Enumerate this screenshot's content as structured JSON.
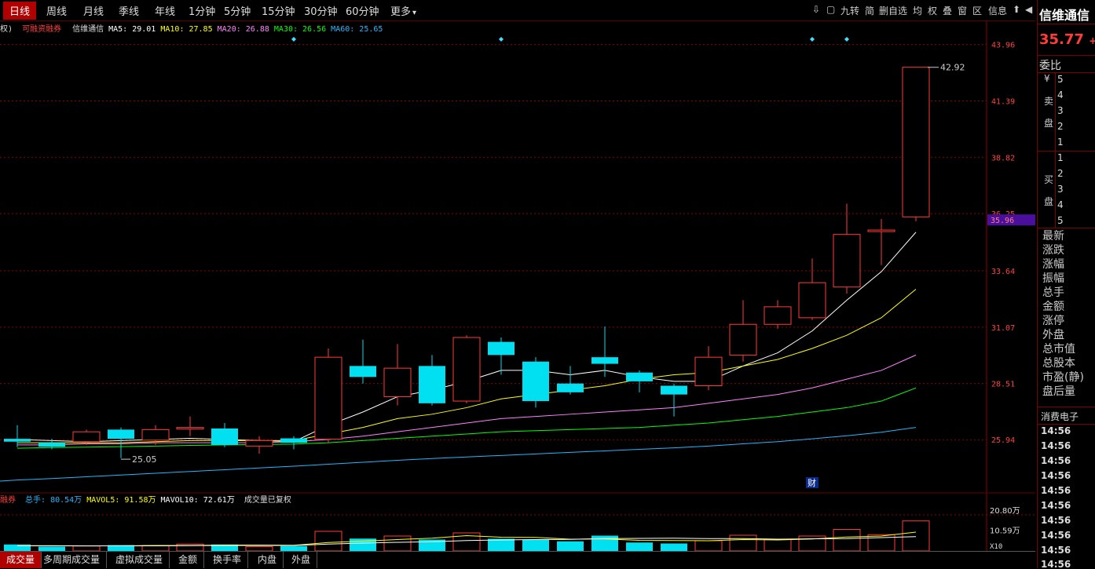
{
  "toolbar": {
    "periods": [
      "日线",
      "周线",
      "月线",
      "季线",
      "年线",
      "1分钟",
      "5分钟",
      "15分钟",
      "30分钟",
      "60分钟",
      "更多"
    ],
    "more_arrow": "▾",
    "tools": [
      "⇩",
      "▢",
      "九转",
      "简",
      "删自选",
      "均",
      "权",
      "叠",
      "窗",
      "区",
      "信息"
    ],
    "back_arrow": "⬆",
    "collapse_arrow": "◀"
  },
  "chart_info": {
    "prefix": "权)",
    "tag": "可融资融券",
    "name": "信维通信",
    "ma5": "MA5: 29.01",
    "ma10": "MA10: 27.85",
    "ma20": "MA20: 26.88",
    "ma30": "MA30: 26.56",
    "ma60": "MA60: 25.65"
  },
  "vol_info": {
    "tag": "融券",
    "total": "总手: 80.54万",
    "mavol5": "MAVOL5: 91.58万",
    "mavol10": "MAVOL10: 72.61万",
    "note": "成交量已复权"
  },
  "price_axis": [
    "43.96",
    "41.39",
    "38.82",
    "36.25",
    "33.64",
    "31.07",
    "28.51",
    "25.94"
  ],
  "current_price_tag": "35.96",
  "volume_axis": [
    "20.80万",
    "10.59万"
  ],
  "volume_unit": "X10",
  "annotations": {
    "high": "42.92",
    "low": "25.05",
    "finance_marker": "财"
  },
  "colors": {
    "up": "#ff3b3b",
    "down": "#00e0f0",
    "ma5": "#ffffff",
    "ma10": "#ffff00",
    "ma20": "#ff80ff",
    "ma30": "#00ff00",
    "ma60": "#1fb8ff",
    "grid": "#8b0000",
    "axis_text": "#ff4040"
  },
  "chart_data": {
    "type": "candlestick",
    "y_range": [
      23.3,
      44.7
    ],
    "candles": [
      {
        "o": 25.98,
        "c": 25.85,
        "h": 26.6,
        "l": 25.6,
        "v": 3.3
      },
      {
        "o": 25.8,
        "c": 25.62,
        "h": 25.98,
        "l": 25.5,
        "v": 2.2
      },
      {
        "o": 25.85,
        "c": 26.3,
        "h": 26.4,
        "l": 25.7,
        "v": 2.5
      },
      {
        "o": 26.4,
        "c": 25.98,
        "h": 26.5,
        "l": 25.1,
        "v": 3.0
      },
      {
        "o": 25.92,
        "c": 26.4,
        "h": 26.6,
        "l": 25.7,
        "v": 2.8
      },
      {
        "o": 26.5,
        "c": 26.5,
        "h": 27.0,
        "l": 26.1,
        "v": 3.5
      },
      {
        "o": 26.45,
        "c": 25.7,
        "h": 26.7,
        "l": 25.6,
        "v": 3.3
      },
      {
        "o": 25.65,
        "c": 25.9,
        "h": 26.1,
        "l": 25.3,
        "v": 2.2
      },
      {
        "o": 26.0,
        "c": 25.8,
        "h": 26.1,
        "l": 25.5,
        "v": 2.5
      },
      {
        "o": 25.96,
        "c": 29.7,
        "h": 30.1,
        "l": 25.8,
        "v": 10.0
      },
      {
        "o": 29.3,
        "c": 28.8,
        "h": 30.5,
        "l": 28.5,
        "v": 6.3
      },
      {
        "o": 27.9,
        "c": 29.2,
        "h": 30.3,
        "l": 27.5,
        "v": 7.6
      },
      {
        "o": 29.3,
        "c": 27.6,
        "h": 29.8,
        "l": 27.5,
        "v": 5.8
      },
      {
        "o": 27.7,
        "c": 30.6,
        "h": 30.7,
        "l": 27.6,
        "v": 9.2
      },
      {
        "o": 30.4,
        "c": 29.8,
        "h": 30.6,
        "l": 28.9,
        "v": 6.2
      },
      {
        "o": 29.5,
        "c": 27.7,
        "h": 29.7,
        "l": 27.4,
        "v": 5.8
      },
      {
        "o": 28.5,
        "c": 28.1,
        "h": 29.3,
        "l": 28.0,
        "v": 4.9
      },
      {
        "o": 29.7,
        "c": 29.4,
        "h": 31.1,
        "l": 28.8,
        "v": 7.8
      },
      {
        "o": 29.0,
        "c": 28.6,
        "h": 29.1,
        "l": 28.1,
        "v": 4.3
      },
      {
        "o": 28.4,
        "c": 28.0,
        "h": 28.5,
        "l": 27.0,
        "v": 3.8
      },
      {
        "o": 28.4,
        "c": 29.7,
        "h": 30.2,
        "l": 28.2,
        "v": 5.2
      },
      {
        "o": 29.8,
        "c": 31.2,
        "h": 32.3,
        "l": 29.5,
        "v": 8.0
      },
      {
        "o": 31.2,
        "c": 32.0,
        "h": 32.3,
        "l": 31.0,
        "v": 5.8
      },
      {
        "o": 31.5,
        "c": 33.1,
        "h": 34.2,
        "l": 31.4,
        "v": 7.6
      },
      {
        "o": 32.9,
        "c": 35.3,
        "h": 36.7,
        "l": 32.6,
        "v": 11.0
      },
      {
        "o": 35.5,
        "c": 35.5,
        "h": 36.0,
        "l": 33.9,
        "v": 8.3
      },
      {
        "o": 36.1,
        "c": 42.92,
        "h": 42.92,
        "l": 35.9,
        "v": 15.3
      }
    ],
    "ma": {
      "ma5": [
        25.95,
        25.9,
        25.85,
        25.9,
        25.95,
        26.0,
        25.95,
        25.9,
        25.85,
        26.6,
        27.2,
        27.9,
        28.2,
        28.6,
        29.1,
        29.1,
        28.9,
        29.1,
        28.8,
        28.6,
        28.6,
        29.3,
        29.9,
        30.9,
        32.3,
        33.6,
        35.4
      ],
      "ma10": [
        25.8,
        25.8,
        25.8,
        25.8,
        25.85,
        25.9,
        25.9,
        25.9,
        25.9,
        26.2,
        26.5,
        26.9,
        27.1,
        27.4,
        27.8,
        28.0,
        28.2,
        28.4,
        28.7,
        28.9,
        29.0,
        29.3,
        29.6,
        30.1,
        30.7,
        31.5,
        32.8
      ],
      "ma20": [
        25.7,
        25.7,
        25.75,
        25.75,
        25.8,
        25.8,
        25.8,
        25.8,
        25.85,
        25.95,
        26.1,
        26.3,
        26.5,
        26.7,
        26.9,
        27.0,
        27.1,
        27.2,
        27.3,
        27.4,
        27.6,
        27.8,
        28.0,
        28.3,
        28.7,
        29.1,
        29.8
      ],
      "ma30": [
        25.55,
        25.58,
        25.6,
        25.62,
        25.65,
        25.68,
        25.7,
        25.72,
        25.74,
        25.8,
        25.9,
        26.0,
        26.1,
        26.2,
        26.3,
        26.35,
        26.4,
        26.45,
        26.5,
        26.6,
        26.7,
        26.85,
        27.0,
        27.2,
        27.4,
        27.7,
        28.3
      ],
      "ma60": [
        24.1,
        24.17,
        24.25,
        24.33,
        24.41,
        24.49,
        24.57,
        24.65,
        24.73,
        24.82,
        24.91,
        25.0,
        25.08,
        25.15,
        25.22,
        25.29,
        25.36,
        25.43,
        25.5,
        25.57,
        25.65,
        25.75,
        25.85,
        25.98,
        26.12,
        26.28,
        26.5
      ]
    },
    "mavol5": [
      2.7,
      2.7,
      2.6,
      2.6,
      2.8,
      2.8,
      3.0,
      3.0,
      2.9,
      4.3,
      5.0,
      5.8,
      6.5,
      7.8,
      7.0,
      6.9,
      6.0,
      6.1,
      5.4,
      5.3,
      5.2,
      5.8,
      5.6,
      6.1,
      7.1,
      7.6,
      9.6
    ],
    "mavol10": [
      2.6,
      2.6,
      2.6,
      2.6,
      2.6,
      2.7,
      2.8,
      2.8,
      2.8,
      3.5,
      4.0,
      4.4,
      4.7,
      5.3,
      5.6,
      5.8,
      5.9,
      6.3,
      6.4,
      6.5,
      6.3,
      6.3,
      6.0,
      6.2,
      6.3,
      6.8,
      7.3
    ],
    "volume_range": [
      0,
      20.8
    ]
  },
  "right_panel": {
    "name": "信维通信",
    "price": "35.77",
    "price_suffix": "+",
    "commission_label": "委比",
    "sell_labels": [
      "¥",
      "卖",
      "盘"
    ],
    "buy_labels": [
      "买",
      "盘"
    ],
    "sell_levels": [
      "5",
      "4",
      "3",
      "2",
      "1"
    ],
    "buy_levels": [
      "1",
      "2",
      "3",
      "4",
      "5"
    ],
    "stats": [
      "最新",
      "涨跌",
      "涨幅",
      "振幅",
      "总手",
      "金额",
      "涨停",
      "外盘",
      "总市值",
      "总股本",
      "市盈(静)",
      "盘后量"
    ],
    "sector": "消费电子",
    "ticks": [
      "14:56",
      "14:56",
      "14:56",
      "14:56",
      "14:56",
      "14:56",
      "14:56",
      "14:56",
      "14:56",
      "14:56"
    ]
  },
  "bottom_tabs": [
    "成交量",
    "多周期成交量",
    "虚拟成交量",
    "金额",
    "换手率",
    "内盘",
    "外盘"
  ]
}
